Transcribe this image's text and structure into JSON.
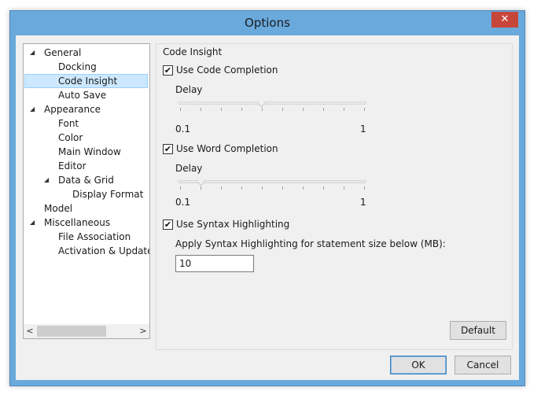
{
  "window": {
    "title": "Options",
    "close_label": "✕"
  },
  "tree": {
    "items": [
      {
        "label": "General",
        "expander": "◢"
      },
      {
        "label": "Docking"
      },
      {
        "label": "Code Insight",
        "selected": true
      },
      {
        "label": "Auto Save"
      },
      {
        "label": "Appearance",
        "expander": "◢"
      },
      {
        "label": "Font"
      },
      {
        "label": "Color"
      },
      {
        "label": "Main Window"
      },
      {
        "label": "Editor"
      },
      {
        "label": "Data & Grid",
        "expander": "◢"
      },
      {
        "label": "Display Format"
      },
      {
        "label": "Model"
      },
      {
        "label": "Miscellaneous",
        "expander": "◢"
      },
      {
        "label": "File Association"
      },
      {
        "label": "Activation & Updater"
      }
    ],
    "scroll_left": "<",
    "scroll_right": ">"
  },
  "panel": {
    "group_title": "Code Insight",
    "code_completion": {
      "label": "Use Code Completion",
      "checked": true,
      "delay_label": "Delay",
      "min": "0.1",
      "max": "1",
      "value": 0.45
    },
    "word_completion": {
      "label": "Use Word Completion",
      "checked": true,
      "delay_label": "Delay",
      "min": "0.1",
      "max": "1",
      "value": 0.1
    },
    "syntax": {
      "label": "Use Syntax Highlighting",
      "checked": true,
      "size_label": "Apply Syntax Highlighting for statement size below (MB):",
      "size_value": "10"
    },
    "default_button": "Default"
  },
  "footer": {
    "ok": "OK",
    "cancel": "Cancel"
  },
  "check_mark": "✔"
}
